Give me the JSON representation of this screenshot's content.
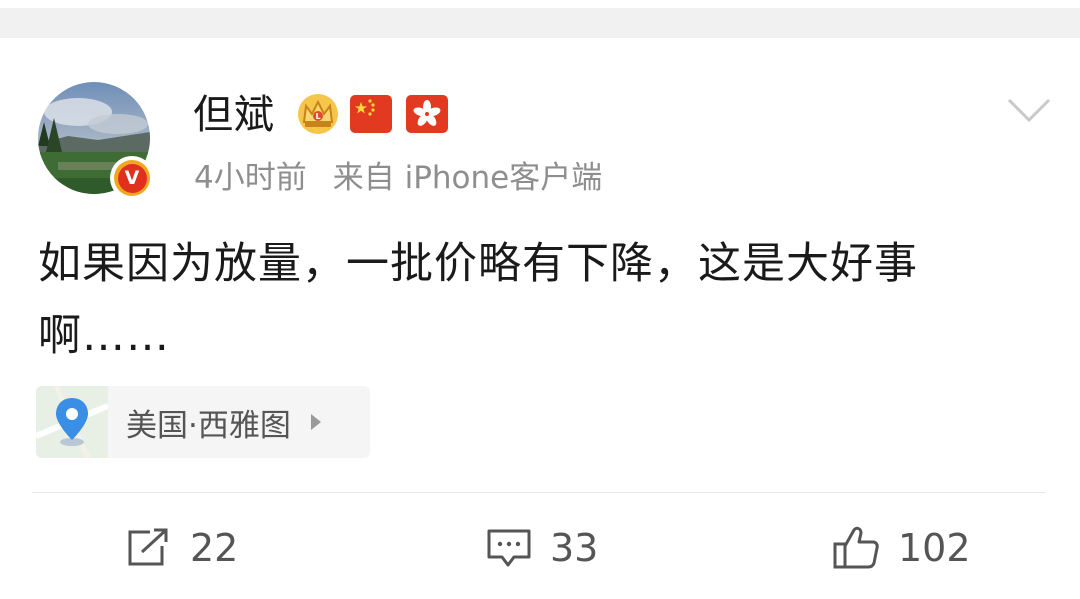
{
  "post": {
    "author": "但斌",
    "time": "4小时前",
    "source": "来自 iPhone客户端",
    "text": "如果因为放量，一批价略有下降，这是大好事啊……",
    "location": "美国·西雅图"
  },
  "badges": [
    "crown-icon",
    "china-flag-icon",
    "hong-kong-flag-icon"
  ],
  "actions": {
    "repost_count": "22",
    "comment_count": "33",
    "like_count": "102"
  },
  "colors": {
    "verified_badge": "#e0311e",
    "text": "#1a1a1a",
    "meta": "#8e8e8e",
    "location_pin": "#3a8ee6"
  }
}
